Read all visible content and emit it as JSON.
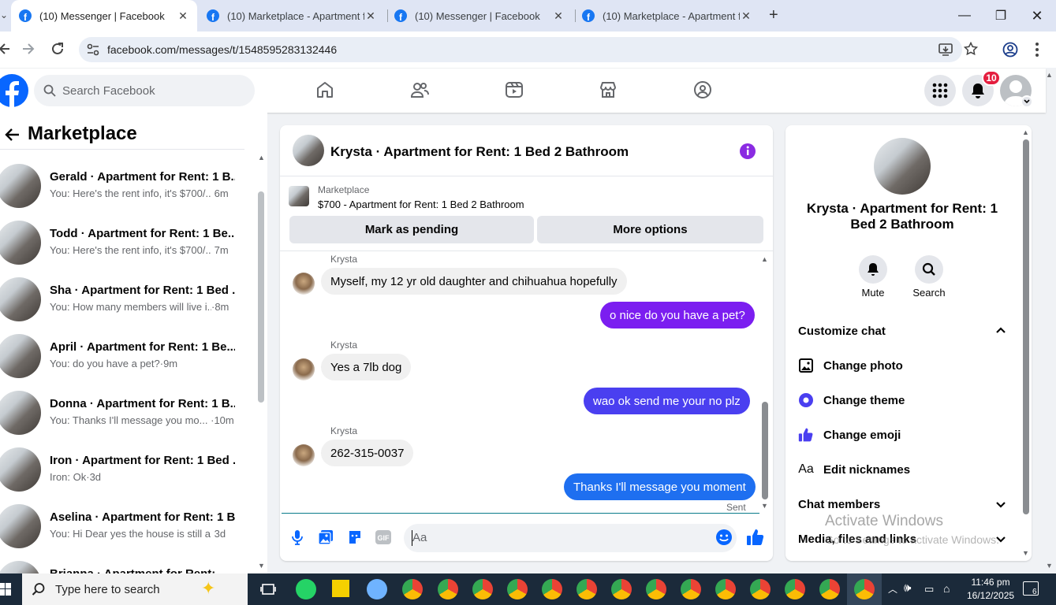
{
  "browser": {
    "tabs": [
      {
        "label": "(10) Messenger | Facebook",
        "active": true
      },
      {
        "label": "(10) Marketplace - Apartment f…",
        "active": false
      },
      {
        "label": "(10) Messenger | Facebook",
        "active": false
      },
      {
        "label": "(10) Marketplace - Apartment f…",
        "active": false
      }
    ],
    "url": "facebook.com/messages/t/1548595283132446"
  },
  "topnav": {
    "search_placeholder": "Search Facebook",
    "notification_count": "10"
  },
  "marketplace": {
    "title": "Marketplace",
    "conversations": [
      {
        "name": "Gerald · Apartment for Rent: 1 B...",
        "preview": "You: Here's the rent info, it's $700/...",
        "time": "6m"
      },
      {
        "name": "Todd · Apartment for Rent: 1 Be...",
        "preview": "You: Here's the rent info, it's $700/...",
        "time": "7m"
      },
      {
        "name": "Sha · Apartment for Rent: 1 Bed ...",
        "preview": "You: How many members will live i...",
        "time": "·8m"
      },
      {
        "name": "April · Apartment for Rent: 1 Be...",
        "preview": "You: do you have a pet?",
        "time": "·9m"
      },
      {
        "name": "Donna · Apartment for Rent: 1 B...",
        "preview": "You: Thanks I'll message you mo...",
        "time": "·10m"
      },
      {
        "name": "Iron · Apartment for Rent: 1 Bed ...",
        "preview": "Iron: Ok",
        "time": "·3d"
      },
      {
        "name": "Aselina · Apartment for Rent: 1 B...",
        "preview": "You: Hi Dear yes the house is still a...",
        "time": "3d"
      },
      {
        "name": "Brianna · Apartment for Rent: ...",
        "preview": "",
        "time": ""
      }
    ]
  },
  "chat": {
    "title": "Krysta · Apartment for Rent: 1 Bed 2 Bathroom",
    "listing_label": "Marketplace",
    "listing_title": "$700 - Apartment for Rent: 1 Bed 2 Bathroom",
    "mark_pending": "Mark as pending",
    "more_options": "More options",
    "messages": [
      {
        "sender": "Krysta",
        "text": "Myself, my 12 yr old daughter and chihuahua hopefully",
        "direction": "in"
      },
      {
        "sender": "",
        "text": "o nice do you have a pet?",
        "direction": "out"
      },
      {
        "sender": "Krysta",
        "text": "Yes a 7lb dog",
        "direction": "in"
      },
      {
        "sender": "",
        "text": "wao ok send me your  no plz",
        "direction": "out"
      },
      {
        "sender": "Krysta",
        "text": "262-315-0037",
        "direction": "in"
      },
      {
        "sender": "",
        "text": "Thanks I'll message you moment",
        "direction": "out"
      }
    ],
    "status": "Sent",
    "composer_placeholder": "Aa"
  },
  "info_panel": {
    "name": "Krysta · Apartment for Rent: 1 Bed 2 Bathroom",
    "mute_label": "Mute",
    "search_label": "Search",
    "customize_title": "Customize chat",
    "customize_items": [
      "Change photo",
      "Change theme",
      "Change emoji",
      "Edit nicknames"
    ],
    "chat_members": "Chat members",
    "media_files": "Media, files and links"
  },
  "watermark": {
    "line1": "Activate Windows",
    "line2": "Go to Settings to activate Windows."
  },
  "taskbar": {
    "search_placeholder": "Type here to search",
    "time": "11:46 pm",
    "date": "16/12/2025",
    "notification_count": "6"
  },
  "colors": {
    "accent_purple": "#8a2be2",
    "bubble_out_a": "#7b1ef0",
    "bubble_out_b": "#4a3ff0",
    "bubble_out_c": "#1e6ff0",
    "facebook_blue": "#1877f2"
  }
}
